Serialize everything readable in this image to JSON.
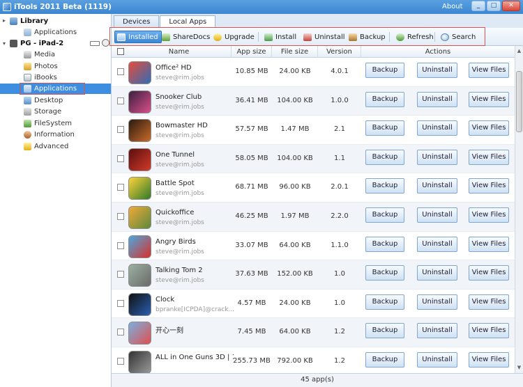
{
  "window": {
    "title": "iTools 2011 Beta (1119)",
    "about_label": "About",
    "min_glyph": "_",
    "max_glyph": "□",
    "close_glyph": "✕"
  },
  "sidebar": {
    "library_label": "Library",
    "library_apps_label": "Applications",
    "device_label": "PG - iPad-2",
    "items": [
      {
        "label": "Media",
        "icon": "media-icon"
      },
      {
        "label": "Photos",
        "icon": "photos-icon"
      },
      {
        "label": "iBooks",
        "icon": "ibooks-icon"
      },
      {
        "label": "Applications",
        "icon": "applications-icon"
      },
      {
        "label": "Desktop",
        "icon": "desktop-icon"
      },
      {
        "label": "Storage",
        "icon": "storage-icon"
      },
      {
        "label": "FileSystem",
        "icon": "filesystem-icon"
      },
      {
        "label": "Information",
        "icon": "information-icon"
      },
      {
        "label": "Advanced",
        "icon": "advanced-icon"
      }
    ]
  },
  "tabs": {
    "devices": "Devices",
    "local_apps": "Local Apps"
  },
  "toolbar": {
    "installed": "Installed",
    "sharedocs": "ShareDocs",
    "upgrade": "Upgrade",
    "install": "Install",
    "uninstall": "Uninstall",
    "backup": "Backup",
    "refresh": "Refresh",
    "search": "Search"
  },
  "table": {
    "columns": {
      "name": "Name",
      "app_size": "App size",
      "file_size": "File size",
      "version": "Version",
      "actions": "Actions"
    },
    "action_labels": {
      "backup": "Backup",
      "uninstall": "Uninstall",
      "view_files": "View Files"
    },
    "rows": [
      {
        "name": "Office² HD",
        "author": "steve@rim.jobs",
        "app_size": "10.85 MB",
        "file_size": "24.00 KB",
        "version": "4.0.1"
      },
      {
        "name": "Snooker Club",
        "author": "steve@rim.jobs",
        "app_size": "36.41 MB",
        "file_size": "104.00 KB",
        "version": "1.0.0"
      },
      {
        "name": "Bowmaster HD",
        "author": "steve@rim.jobs",
        "app_size": "57.57 MB",
        "file_size": "1.47 MB",
        "version": "2.1"
      },
      {
        "name": "One Tunnel",
        "author": "steve@rim.jobs",
        "app_size": "58.05 MB",
        "file_size": "104.00 KB",
        "version": "1.1"
      },
      {
        "name": "Battle Spot",
        "author": "steve@rim.jobs",
        "app_size": "68.71 MB",
        "file_size": "96.00 KB",
        "version": "2.0.1"
      },
      {
        "name": "Quickoffice",
        "author": "steve@rim.jobs",
        "app_size": "46.25 MB",
        "file_size": "1.97 MB",
        "version": "2.2.0"
      },
      {
        "name": "Angry Birds",
        "author": "steve@rim.jobs",
        "app_size": "33.07 MB",
        "file_size": "64.00 KB",
        "version": "1.1.0"
      },
      {
        "name": "Talking Tom 2",
        "author": "steve@rim.jobs",
        "app_size": "37.63 MB",
        "file_size": "152.00 KB",
        "version": "1.0"
      },
      {
        "name": "Clock",
        "author": "bpranke[ICPDA]@crack...",
        "app_size": "4.57 MB",
        "file_size": "24.00 KB",
        "version": "1.0"
      },
      {
        "name": "开心一刻",
        "author": "",
        "app_size": "7.45 MB",
        "file_size": "64.00 KB",
        "version": "1.2"
      },
      {
        "name": "ALL in One Guns 3D | 1...",
        "author": "",
        "app_size": "255.73 MB",
        "file_size": "792.00 KB",
        "version": "1.2"
      }
    ]
  },
  "status": {
    "count": "45 app(s)"
  },
  "colors": {
    "accent": "#3d8ee0",
    "highlight_outline": "#d9534f"
  }
}
